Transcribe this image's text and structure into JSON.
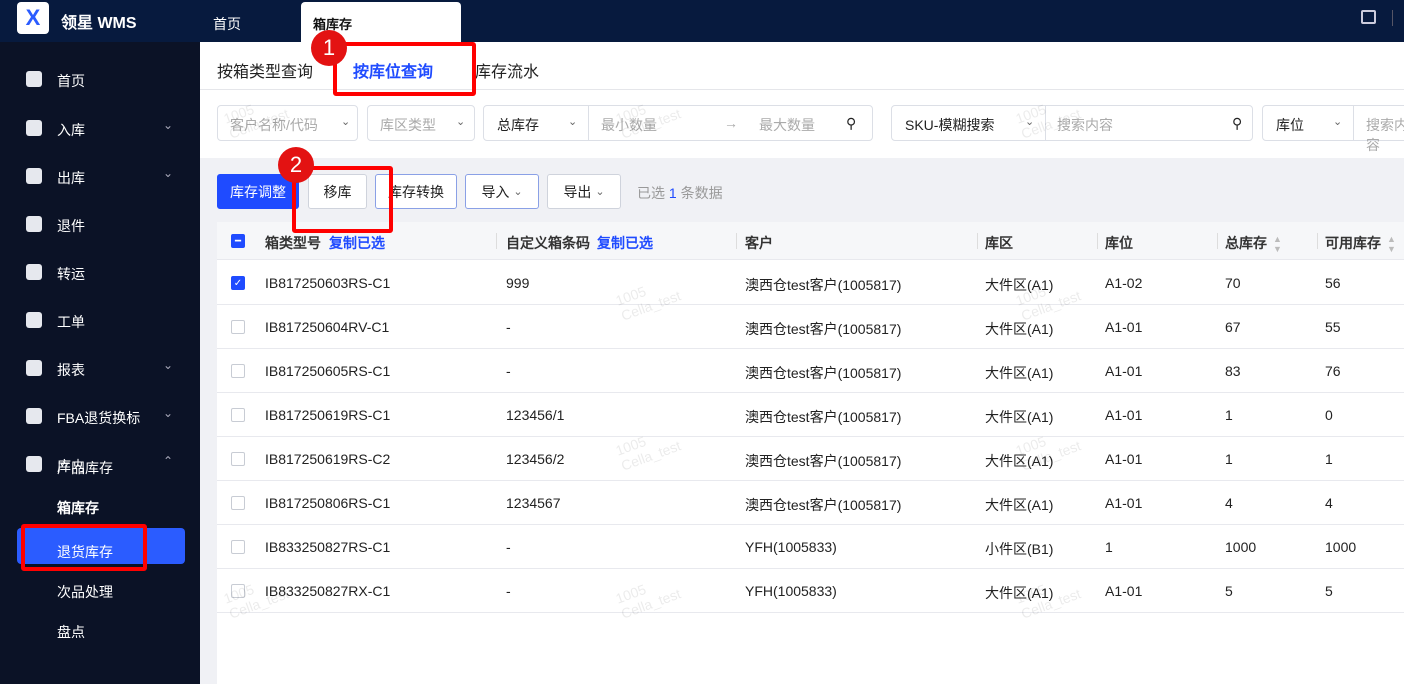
{
  "app": {
    "brand": "领星 WMS",
    "logo": "X"
  },
  "top_tabs": [
    "首页",
    "箱库存"
  ],
  "sidebar": {
    "items": [
      {
        "label": "首页",
        "icon": "home-icon",
        "chev": false
      },
      {
        "label": "入库",
        "icon": "inbound-icon",
        "chev": true
      },
      {
        "label": "出库",
        "icon": "outbound-icon",
        "chev": true
      },
      {
        "label": "退件",
        "icon": "return-icon",
        "chev": false
      },
      {
        "label": "转运",
        "icon": "transfer-icon",
        "chev": false
      },
      {
        "label": "工单",
        "icon": "workorder-icon",
        "chev": false
      },
      {
        "label": "报表",
        "icon": "report-icon",
        "chev": true
      },
      {
        "label": "FBA退货换标",
        "icon": "fba-icon",
        "chev": true
      },
      {
        "label": "库内",
        "icon": "warehouse-icon",
        "chev": true
      }
    ],
    "sub_items": [
      "产品库存",
      "箱库存",
      "退货库存",
      "次品处理",
      "盘点"
    ]
  },
  "query_tabs": [
    "按箱类型查询",
    "按库位查询",
    "库存流水"
  ],
  "filters": {
    "customer": "客户名称/代码",
    "zone_type": "库区类型",
    "qty_type": "总库存",
    "min": "最小数量",
    "max": "最大数量",
    "sku_mode": "SKU-模糊搜索",
    "search": "搜索内容",
    "loc_mode": "库位",
    "search2": "搜索内容"
  },
  "toolbar": {
    "adjust": "库存调整",
    "move": "移库",
    "convert": "库存转换",
    "import": "导入",
    "export": "导出",
    "selected_prefix": "已选",
    "selected_count": "1",
    "selected_suffix": "条数据"
  },
  "table": {
    "headers": {
      "box_type": "箱类型号",
      "copy1": "复制已选",
      "barcode": "自定义箱条码",
      "copy2": "复制已选",
      "customer": "客户",
      "zone": "库区",
      "location": "库位",
      "total": "总库存",
      "available": "可用库存"
    },
    "rows": [
      {
        "checked": true,
        "box": "IB817250603RS-C1",
        "code": "999",
        "customer": "澳西仓test客户(1005817)",
        "zone": "大件区(A1)",
        "loc": "A1-02",
        "total": "70",
        "avail": "56"
      },
      {
        "checked": false,
        "box": "IB817250604RV-C1",
        "code": "-",
        "customer": "澳西仓test客户(1005817)",
        "zone": "大件区(A1)",
        "loc": "A1-01",
        "total": "67",
        "avail": "55"
      },
      {
        "checked": false,
        "box": "IB817250605RS-C1",
        "code": "-",
        "customer": "澳西仓test客户(1005817)",
        "zone": "大件区(A1)",
        "loc": "A1-01",
        "total": "83",
        "avail": "76"
      },
      {
        "checked": false,
        "box": "IB817250619RS-C1",
        "code": "123456/1",
        "customer": "澳西仓test客户(1005817)",
        "zone": "大件区(A1)",
        "loc": "A1-01",
        "total": "1",
        "avail": "0"
      },
      {
        "checked": false,
        "box": "IB817250619RS-C2",
        "code": "123456/2",
        "customer": "澳西仓test客户(1005817)",
        "zone": "大件区(A1)",
        "loc": "A1-01",
        "total": "1",
        "avail": "1"
      },
      {
        "checked": false,
        "box": "IB817250806RS-C1",
        "code": "1234567",
        "customer": "澳西仓test客户(1005817)",
        "zone": "大件区(A1)",
        "loc": "A1-01",
        "total": "4",
        "avail": "4"
      },
      {
        "checked": false,
        "box": "IB833250827RS-C1",
        "code": "-",
        "customer": "YFH(1005833)",
        "zone": "小件区(B1)",
        "loc": "1",
        "total": "1000",
        "avail": "1000"
      },
      {
        "checked": false,
        "box": "IB833250827RX-C1",
        "code": "-",
        "customer": "YFH(1005833)",
        "zone": "大件区(A1)",
        "loc": "A1-01",
        "total": "5",
        "avail": "5"
      }
    ]
  },
  "annotations": [
    "1",
    "2"
  ],
  "watermark": {
    "line1": "1005",
    "line2": "Cella_test"
  }
}
